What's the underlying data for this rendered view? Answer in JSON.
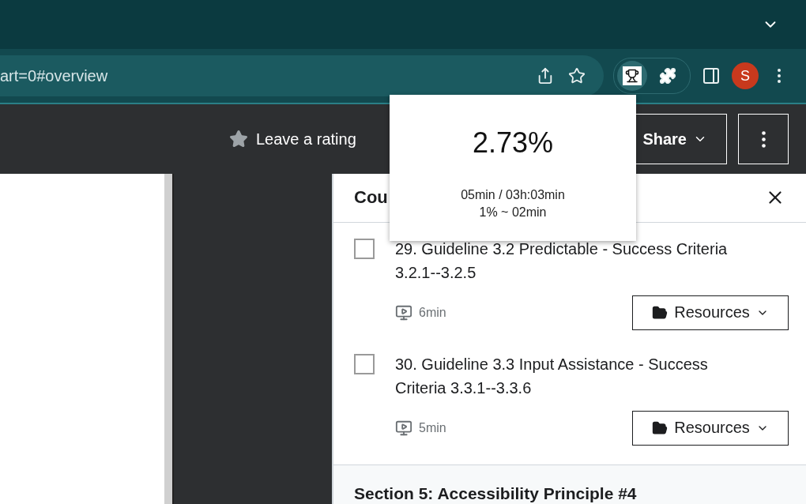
{
  "browser": {
    "address": "art=0#overview",
    "extension_active": true,
    "avatar_letter": "S"
  },
  "header": {
    "rating_link": "Leave a rating",
    "share_button": "Share"
  },
  "popup": {
    "percent": "2.73%",
    "lines": [
      "05min / 03h:03min",
      "1% ~ 02min"
    ]
  },
  "panel": {
    "title": "Cou",
    "lectures": [
      {
        "title": "29. Guideline 3.2 Predictable - Success Criteria 3.2.1--3.2.5",
        "checked": false,
        "duration": "6min",
        "resources": "Resources"
      },
      {
        "title": "30. Guideline 3.3 Input Assistance - Success Criteria 3.3.1--3.3.6",
        "checked": false,
        "duration": "5min",
        "resources": "Resources"
      }
    ],
    "section": "Section 5: Accessibility Principle #4"
  }
}
